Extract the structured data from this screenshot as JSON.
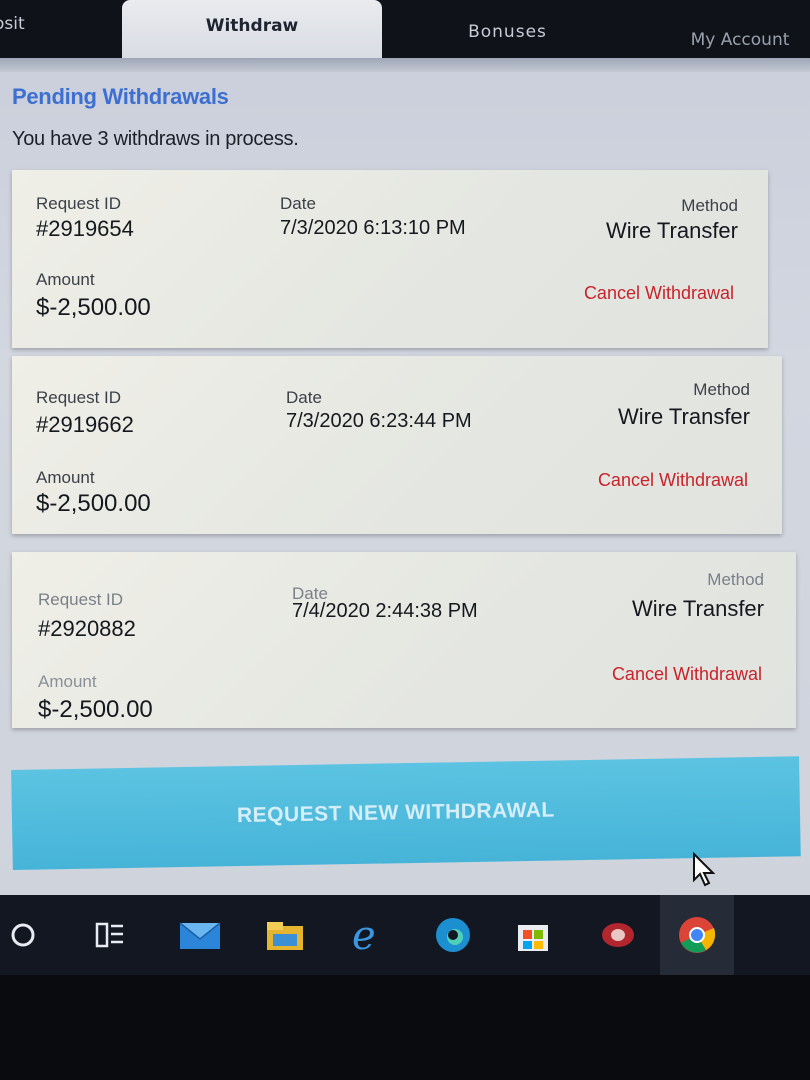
{
  "tabs": {
    "deposit": "osit",
    "withdraw": "Withdraw",
    "bonuses": "Bonuses",
    "account": "My Account"
  },
  "section": {
    "title": "Pending Withdrawals",
    "subtitle": "You have 3 withdraws in process."
  },
  "labels": {
    "request_id": "Request ID",
    "date": "Date",
    "method": "Method",
    "amount": "Amount",
    "cancel": "Cancel Withdrawal"
  },
  "withdrawals": [
    {
      "request_id": "#2919654",
      "date": "7/3/2020 6:13:10 PM",
      "method": "Wire Transfer",
      "amount": "$-2,500.00"
    },
    {
      "request_id": "#2919662",
      "date": "7/3/2020 6:23:44 PM",
      "method": "Wire Transfer",
      "amount": "$-2,500.00"
    },
    {
      "request_id": "#2920882",
      "date": "7/4/2020 2:44:38 PM",
      "method": "Wire Transfer",
      "amount": "$-2,500.00"
    }
  ],
  "request_button": "REQUEST NEW WITHDRAWAL",
  "taskbar": {
    "icons": [
      "start-circle-icon",
      "task-view-icon",
      "mail-icon",
      "file-explorer-icon",
      "internet-explorer-icon",
      "edge-icon",
      "store-icon",
      "app-icon",
      "chrome-icon"
    ]
  },
  "colors": {
    "heading": "#3d6fd0",
    "cancel": "#c8232a",
    "button": "#4fbadc"
  }
}
